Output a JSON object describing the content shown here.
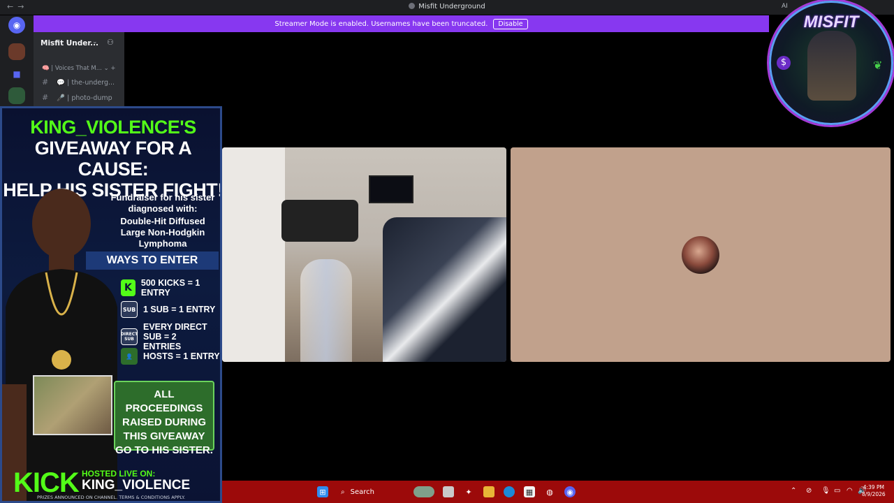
{
  "window": {
    "title": "Misfit Underground",
    "nav_back": "←",
    "nav_forward": "→",
    "ai_label": "AI"
  },
  "banner": {
    "text": "Streamer Mode is enabled. Usernames have been truncated.",
    "disable_label": "Disable",
    "color": "#8738f0"
  },
  "sidebar": {
    "server_name": "Misfit Under...",
    "category": "🧠 | Voices That M...",
    "category_chevron": "⌄",
    "category_add": "+",
    "channels": [
      {
        "hash": "#",
        "emoji": "💬",
        "label": "the-underg..."
      },
      {
        "hash": "#",
        "emoji": "🎤",
        "label": "photo-dump"
      }
    ]
  },
  "ad": {
    "head_line1": "KING_VIOLENCE'S",
    "head_line2": "GIVEAWAY FOR A CAUSE:",
    "head_line3": "HELP HIS SISTER FIGHT!",
    "fund_line1": "Fundraiser for his sister diagnosed with:",
    "fund_line2": "Double-Hit Diffused Large Non-Hodgkin Lymphoma",
    "ways_title": "WAYS TO ENTER",
    "ways": [
      {
        "icon": "K",
        "text": "500 KICKS = 1 ENTRY"
      },
      {
        "icon": "SUB",
        "text": "1 SUB = 1 ENTRY"
      },
      {
        "icon": "DIRECT SUB",
        "text": "EVERY DIRECT SUB = 2 ENTRIES"
      },
      {
        "icon": "👤",
        "text": "HOSTS = 1 ENTRY"
      }
    ],
    "proceeds": "ALL PROCEEDINGS RAISED DURING THIS GIVEAWAY GO TO HIS SISTER.",
    "kick_logo": "KICK",
    "hosted_label": "HOSTED LIVE ON:",
    "host_name": "KING_VIOLENCE",
    "terms": "PRIZES ANNOUNCED ON CHANNEL. TERMS & CONDITIONS APPLY.",
    "accent": "#53fc18"
  },
  "overlay_logo": {
    "text": "MISFIT",
    "dollar": "$",
    "leaf": "❦"
  },
  "taskbar": {
    "search_label": "Search",
    "color": "#9c0a0a",
    "clock_time": "4:39 PM",
    "clock_date": "8/9/2026"
  }
}
